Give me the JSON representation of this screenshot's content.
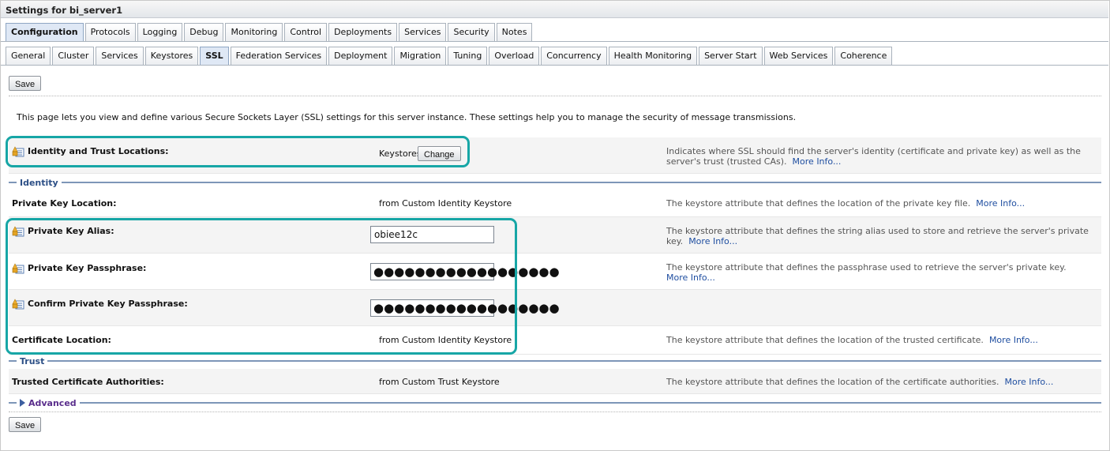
{
  "window": {
    "title": "Settings for bi_server1"
  },
  "main_tabs": [
    {
      "label": "Configuration",
      "active": true
    },
    {
      "label": "Protocols"
    },
    {
      "label": "Logging"
    },
    {
      "label": "Debug"
    },
    {
      "label": "Monitoring"
    },
    {
      "label": "Control"
    },
    {
      "label": "Deployments"
    },
    {
      "label": "Services"
    },
    {
      "label": "Security"
    },
    {
      "label": "Notes"
    }
  ],
  "sub_tabs": [
    {
      "label": "General"
    },
    {
      "label": "Cluster"
    },
    {
      "label": "Services"
    },
    {
      "label": "Keystores"
    },
    {
      "label": "SSL",
      "active": true
    },
    {
      "label": "Federation Services"
    },
    {
      "label": "Deployment"
    },
    {
      "label": "Migration"
    },
    {
      "label": "Tuning"
    },
    {
      "label": "Overload"
    },
    {
      "label": "Concurrency"
    },
    {
      "label": "Health Monitoring"
    },
    {
      "label": "Server Start"
    },
    {
      "label": "Web Services"
    },
    {
      "label": "Coherence"
    }
  ],
  "buttons": {
    "save": "Save",
    "change": "Change"
  },
  "intro": "This page lets you view and define various Secure Sockets Layer (SSL) settings for this server instance. These settings help you to manage the security of message transmissions.",
  "identity_trust": {
    "label": "Identity and Trust Locations:",
    "value": "Keystores",
    "help": "Indicates where SSL should find the server's identity (certificate and private key) as well as the server's trust (trusted CAs).",
    "more": "More Info..."
  },
  "sections": {
    "identity": "Identity",
    "trust": "Trust",
    "advanced": "Advanced"
  },
  "private_key_location": {
    "label": "Private Key Location:",
    "value": "from Custom Identity Keystore",
    "help": "The keystore attribute that defines the location of the private key file.",
    "more": "More Info..."
  },
  "private_key_alias": {
    "label": "Private Key Alias:",
    "value": "obiee12c",
    "help": "The keystore attribute that defines the string alias used to store and retrieve the server's private key.",
    "more": "More Info..."
  },
  "private_key_passphrase": {
    "label": "Private Key Passphrase:",
    "value": "●●●●●●●●●●●●●●●●●●",
    "help": "The keystore attribute that defines the passphrase used to retrieve the server's private key.",
    "more": "More Info..."
  },
  "confirm_passphrase": {
    "label": "Confirm Private Key Passphrase:",
    "value": "●●●●●●●●●●●●●●●●●●"
  },
  "certificate_location": {
    "label": "Certificate Location:",
    "value": "from Custom Identity Keystore",
    "help": "The keystore attribute that defines the location of the trusted certificate.",
    "more": "More Info..."
  },
  "trusted_ca": {
    "label": "Trusted Certificate Authorities:",
    "value": "from Custom Trust Keystore",
    "help": "The keystore attribute that defines the location of the certificate authorities.",
    "more": "More Info..."
  },
  "icons": {
    "changeable": "lock-edit-icon",
    "expand": "triangle-right-icon"
  },
  "colors": {
    "highlight": "#17a6a6",
    "link": "#1f4ea0",
    "section": "#2c4f86"
  }
}
